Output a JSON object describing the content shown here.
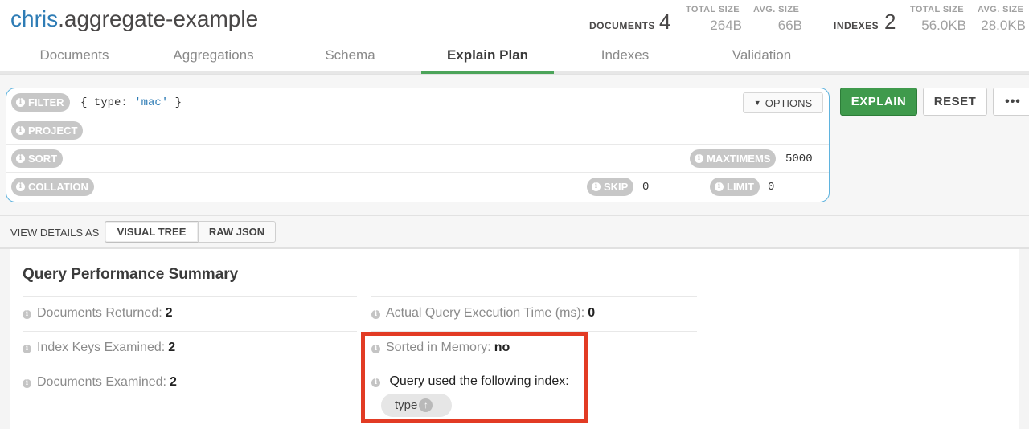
{
  "header": {
    "db": "chris",
    "collection": ".aggregate-example",
    "documents_label": "DOCUMENTS",
    "documents_count": "4",
    "doc_total_size_label": "TOTAL SIZE",
    "doc_total_size": "264B",
    "doc_avg_size_label": "AVG. SIZE",
    "doc_avg_size": "66B",
    "indexes_label": "INDEXES",
    "indexes_count": "2",
    "idx_total_size_label": "TOTAL SIZE",
    "idx_total_size": "56.0KB",
    "idx_avg_size_label": "AVG. SIZE",
    "idx_avg_size": "28.0KB"
  },
  "tabs": [
    {
      "label": "Documents",
      "active": false
    },
    {
      "label": "Aggregations",
      "active": false
    },
    {
      "label": "Schema",
      "active": false
    },
    {
      "label": "Explain Plan",
      "active": true
    },
    {
      "label": "Indexes",
      "active": false
    },
    {
      "label": "Validation",
      "active": false
    }
  ],
  "query": {
    "filter_label": "FILTER",
    "filter_value_prefix": "{ type: ",
    "filter_value_string": "'mac'",
    "filter_value_suffix": " }",
    "options_label": "OPTIONS",
    "project_label": "PROJECT",
    "sort_label": "SORT",
    "maxtimems_label": "MAXTIMEMS",
    "maxtimems_value": "5000",
    "collation_label": "COLLATION",
    "skip_label": "SKIP",
    "skip_value": "0",
    "limit_label": "LIMIT",
    "limit_value": "0"
  },
  "actions": {
    "explain": "EXPLAIN",
    "reset": "RESET",
    "more": "•••"
  },
  "view": {
    "label": "VIEW DETAILS AS",
    "visual_tree": "VISUAL TREE",
    "raw_json": "RAW JSON",
    "active": "VISUAL TREE"
  },
  "summary": {
    "title": "Query Performance Summary",
    "docs_returned_label": "Documents Returned:",
    "docs_returned": "2",
    "index_keys_label": "Index Keys Examined:",
    "index_keys": "2",
    "docs_examined_label": "Documents Examined:",
    "docs_examined": "2",
    "exec_time_label": "Actual Query Execution Time (ms):",
    "exec_time": "0",
    "sorted_label": "Sorted in Memory:",
    "sorted": "no",
    "index_used_label": "Query used the following index:",
    "index_name": "type",
    "index_direction_icon": "arrow-up-icon"
  },
  "colors": {
    "accent_green": "#3f9a4c",
    "tab_active_underline": "#4ca45a",
    "query_border": "#5fb3de",
    "highlight": "#e23b24",
    "db_name": "#2e7cb5"
  }
}
